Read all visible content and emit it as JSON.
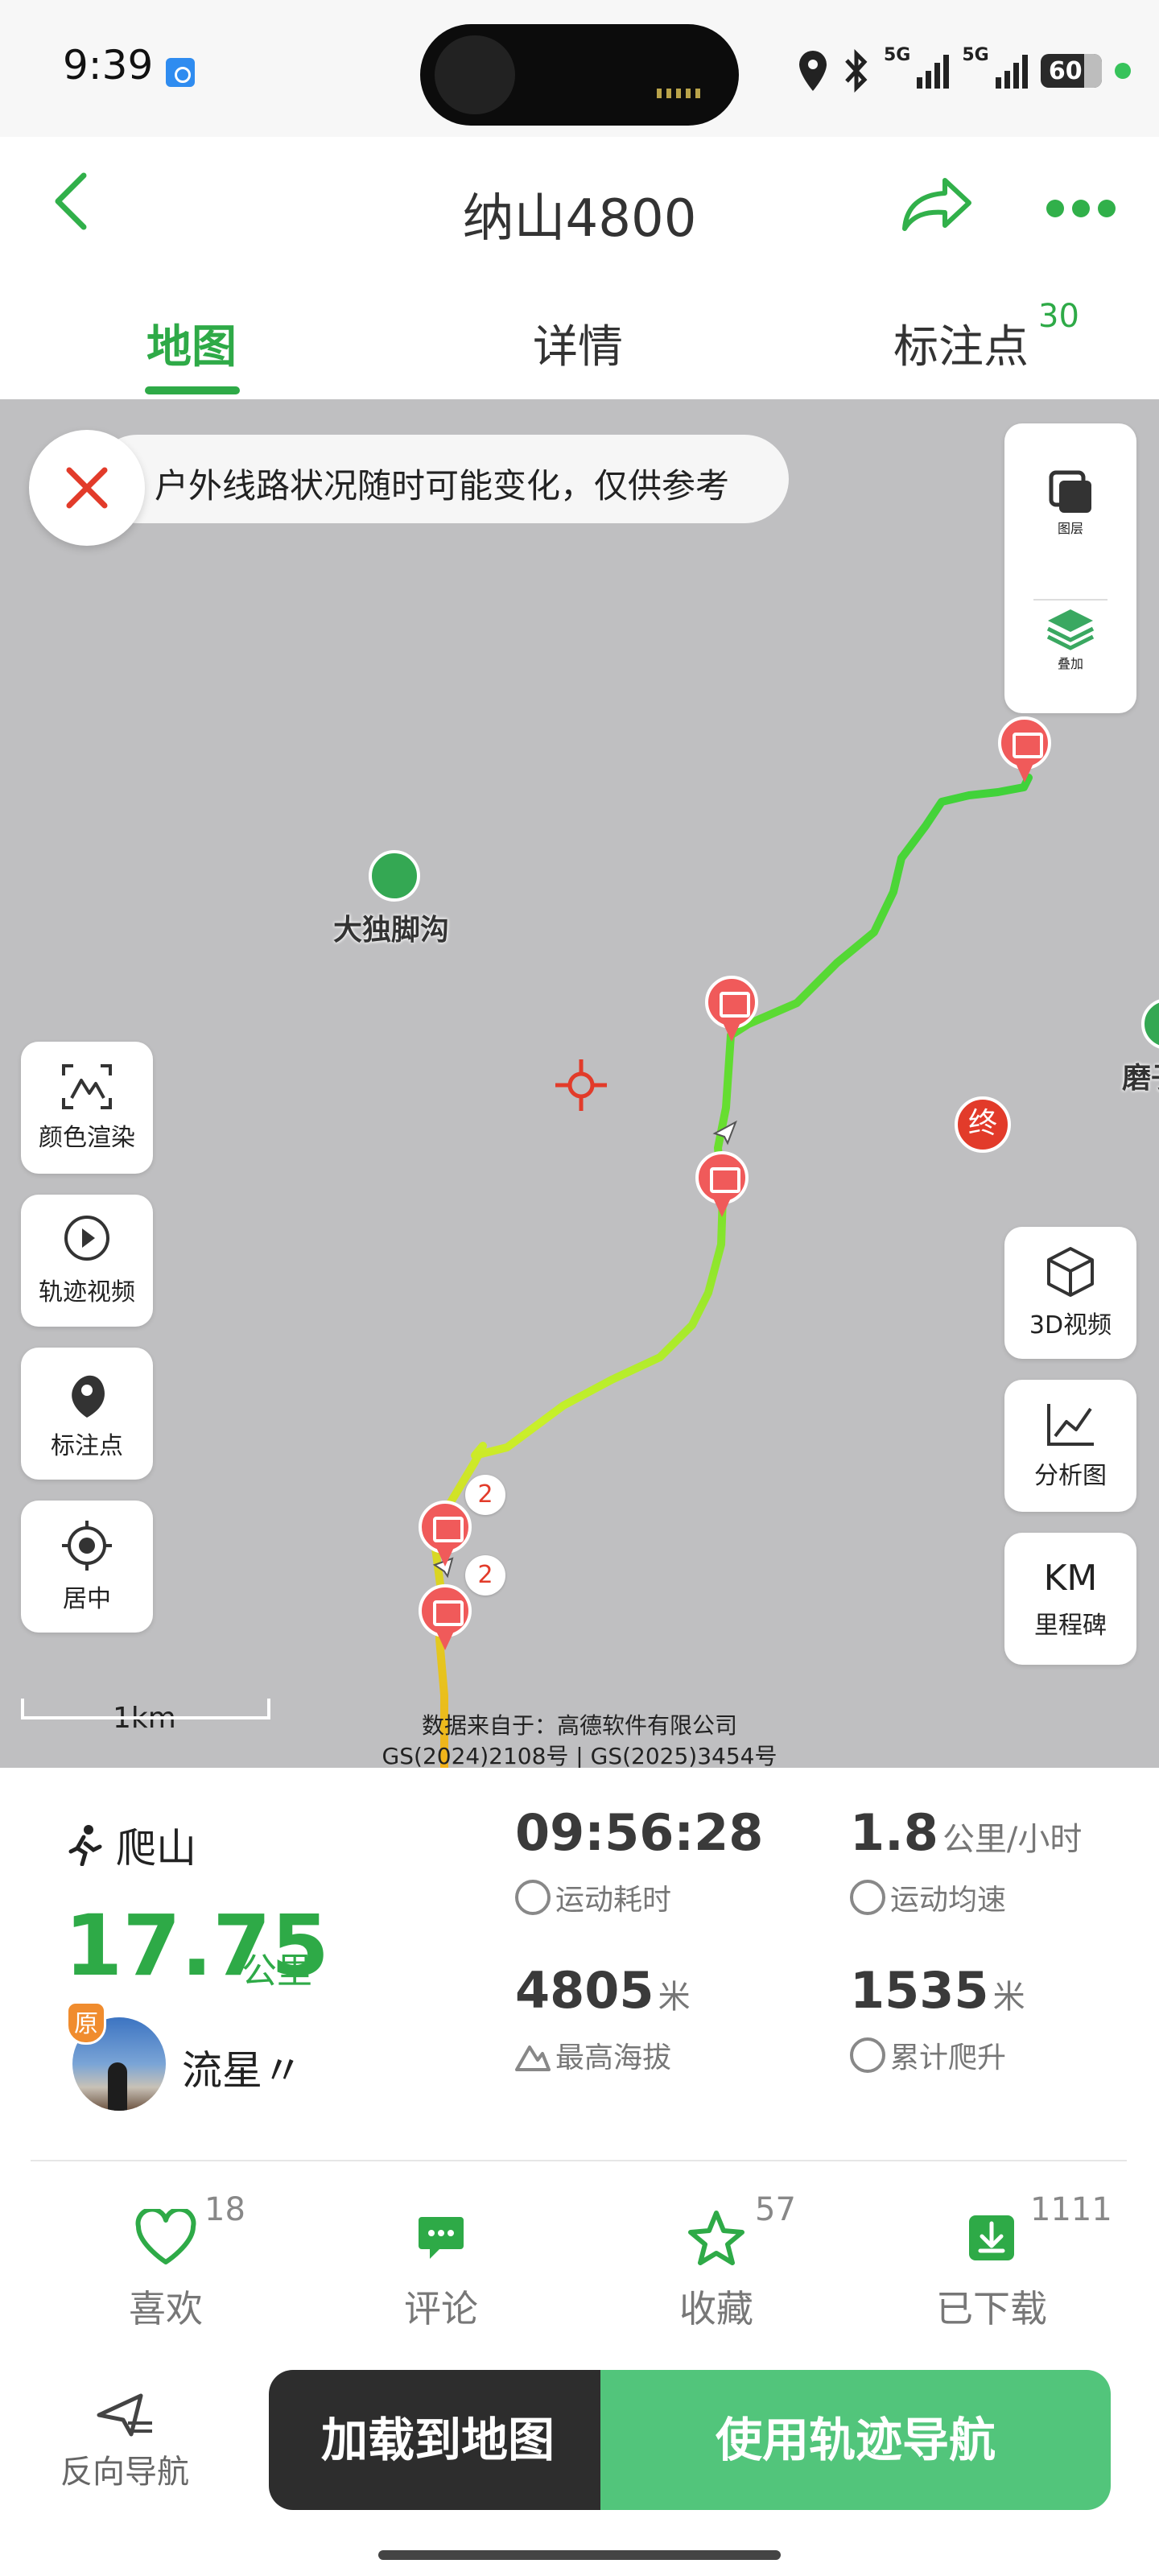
{
  "status_bar": {
    "time": "9:39",
    "battery": "60",
    "network_1": "5G",
    "network_2": "5G"
  },
  "header": {
    "title": "纳山4800"
  },
  "tabs": [
    {
      "label": "地图",
      "active": true
    },
    {
      "label": "详情",
      "active": false
    },
    {
      "label": "标注点",
      "active": false,
      "badge": "30"
    }
  ],
  "map": {
    "notice": "户外线路状况随时可能变化，仅供参考",
    "layer_panel": {
      "layers_label": "图层",
      "overlay_label": "叠加"
    },
    "left_buttons": [
      {
        "label": "颜色渲染",
        "icon": "color-render-icon"
      },
      {
        "label": "轨迹视频",
        "icon": "track-video-icon"
      },
      {
        "label": "标注点",
        "icon": "footprint-icon"
      },
      {
        "label": "居中",
        "icon": "locate-icon"
      }
    ],
    "right_buttons": [
      {
        "label": "3D视频",
        "icon": "cube-icon"
      },
      {
        "label": "分析图",
        "icon": "chart-icon"
      },
      {
        "label": "里程碑",
        "icon_text": "KM"
      }
    ],
    "pois": [
      {
        "label": "大独脚沟"
      },
      {
        "label": "磨子"
      }
    ],
    "end_marker": "终",
    "pin_badges": [
      "2",
      "2"
    ],
    "scale": "1km",
    "attribution_line1": "数据来自于：高德软件有限公司",
    "attribution_line2": "GS(2024)2108号 | GS(2025)3454号",
    "colors": {
      "route_start": "#f2b21a",
      "route_mid": "#c8f02a",
      "route_end": "#3fd23a",
      "pin": "#f05a5a"
    }
  },
  "stats": {
    "sport_type": "爬山",
    "distance": "17.75",
    "distance_unit": "公里",
    "author": "流星〃",
    "original_badge": "原",
    "duration": {
      "value": "09:56:28",
      "label": "运动耗时"
    },
    "avg_speed": {
      "value": "1.8",
      "unit": "公里/小时",
      "label": "运动均速"
    },
    "max_altitude": {
      "value": "4805",
      "unit": "米",
      "label": "最高海拔"
    },
    "total_climb": {
      "value": "1535",
      "unit": "米",
      "label": "累计爬升"
    }
  },
  "actions": [
    {
      "label": "喜欢",
      "count": "18",
      "icon": "heart-icon"
    },
    {
      "label": "评论",
      "count": "",
      "icon": "comment-icon"
    },
    {
      "label": "收藏",
      "count": "57",
      "icon": "star-icon"
    },
    {
      "label": "已下载",
      "count": "1111",
      "icon": "download-icon"
    }
  ],
  "bottom": {
    "reverse_nav": "反向导航",
    "load_to_map": "加载到地图",
    "use_track_nav": "使用轨迹导航"
  },
  "accent_color": "#2eaa47"
}
